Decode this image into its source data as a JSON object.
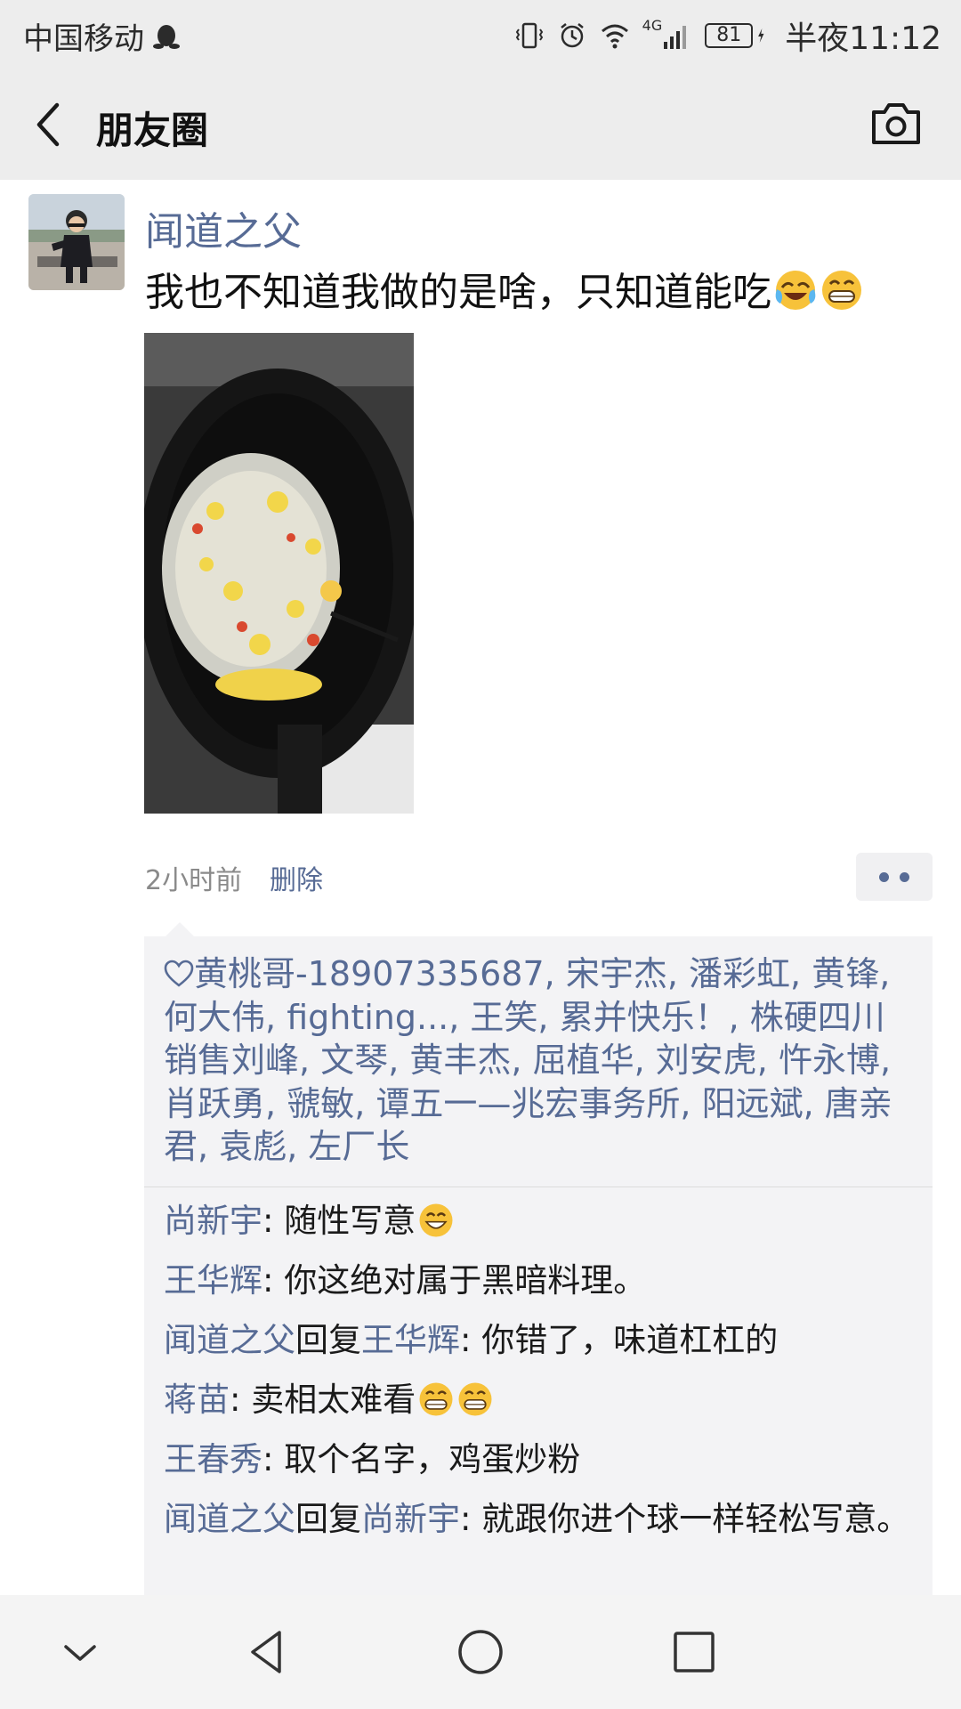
{
  "status_bar": {
    "carrier": "中国移动",
    "network": "4G",
    "battery": "81",
    "time": "半夜11:12"
  },
  "header": {
    "title": "朋友圈"
  },
  "post": {
    "author": "闻道之父",
    "text": "我也不知道我做的是啥，只知道能吃",
    "time": "2小时前",
    "delete_label": "删除",
    "likes": [
      "黄桃哥-18907335687",
      "宋宇杰",
      "潘彩虹",
      "黄锋",
      "何大伟",
      "fighting...",
      "王笑",
      "累并快乐！",
      "株硬四川销售刘峰",
      "文琴",
      "黄丰杰",
      "屈植华",
      "刘安虎",
      "忤永博",
      "肖跃勇",
      "虢敏",
      "谭五一—兆宏事务所",
      "阳远斌",
      "唐亲君",
      "袁彪",
      "左厂长"
    ],
    "comments": [
      {
        "name": "尚新宇",
        "reply_label": "",
        "reply_to": "",
        "text": ": 随性写意"
      },
      {
        "name": "王华辉",
        "reply_label": "",
        "reply_to": "",
        "text": ": 你这绝对属于黑暗料理。"
      },
      {
        "name": "闻道之父",
        "reply_label": "回复",
        "reply_to": "王华辉",
        "text": ": 你错了，味道杠杠的"
      },
      {
        "name": "蒋苗",
        "reply_label": "",
        "reply_to": "",
        "text": ": 卖相太难看"
      },
      {
        "name": "王春秀",
        "reply_label": "",
        "reply_to": "",
        "text": ": 取个名字，鸡蛋炒粉"
      },
      {
        "name": "闻道之父",
        "reply_label": "回复",
        "reply_to": "尚新宇",
        "text": ": 就跟你进个球一样轻松写意。"
      }
    ]
  },
  "colors": {
    "link_blue": "#576b95",
    "header_bg": "#ededed",
    "comment_bg": "#f3f3f5"
  }
}
